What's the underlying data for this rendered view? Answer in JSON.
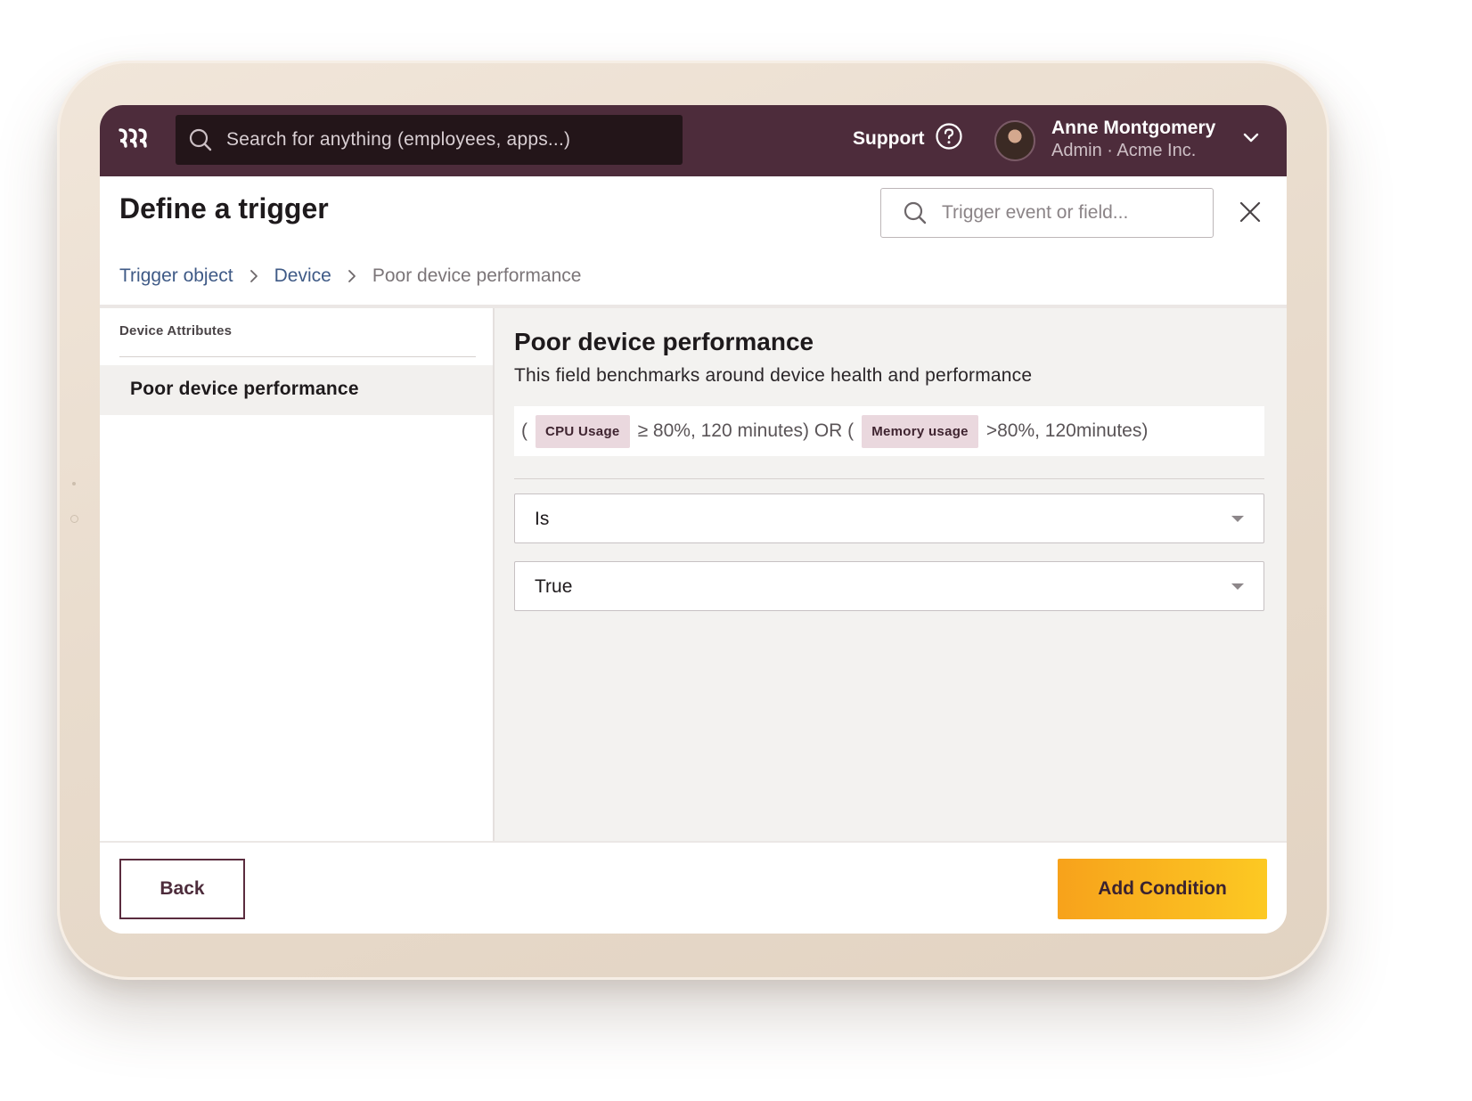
{
  "topbar": {
    "search_placeholder": "Search for anything (employees, apps...)",
    "support_label": "Support",
    "user_name": "Anne Montgomery",
    "user_role": "Admin · Acme Inc."
  },
  "header": {
    "title": "Define a trigger",
    "search_placeholder": "Trigger event or field..."
  },
  "breadcrumb": [
    {
      "label": "Trigger object"
    },
    {
      "label": "Device"
    },
    {
      "label": "Poor device performance"
    }
  ],
  "sidebar": {
    "heading": "Device Attributes",
    "items": [
      {
        "label": "Poor device performance",
        "selected": true
      }
    ]
  },
  "detail": {
    "title": "Poor device performance",
    "description": "This field benchmarks around device health and performance",
    "formula": {
      "open": "(",
      "tag1": "CPU Usage",
      "mid": "≥ 80%, 120 minutes) OR (",
      "tag2": "Memory usage",
      "end": ">80%, 120minutes)"
    },
    "operator_select": "Is",
    "value_select": "True"
  },
  "footer": {
    "back_label": "Back",
    "add_label": "Add Condition"
  },
  "colors": {
    "topbar": "#4d2c3b",
    "accent": "#fcb41f",
    "link": "#3f5a86",
    "tag_bg": "#ead8de"
  },
  "icons": [
    "logo-icon",
    "search-icon",
    "help-icon",
    "chevron-down-icon",
    "close-icon",
    "chevron-right-icon",
    "caret-down-icon"
  ]
}
